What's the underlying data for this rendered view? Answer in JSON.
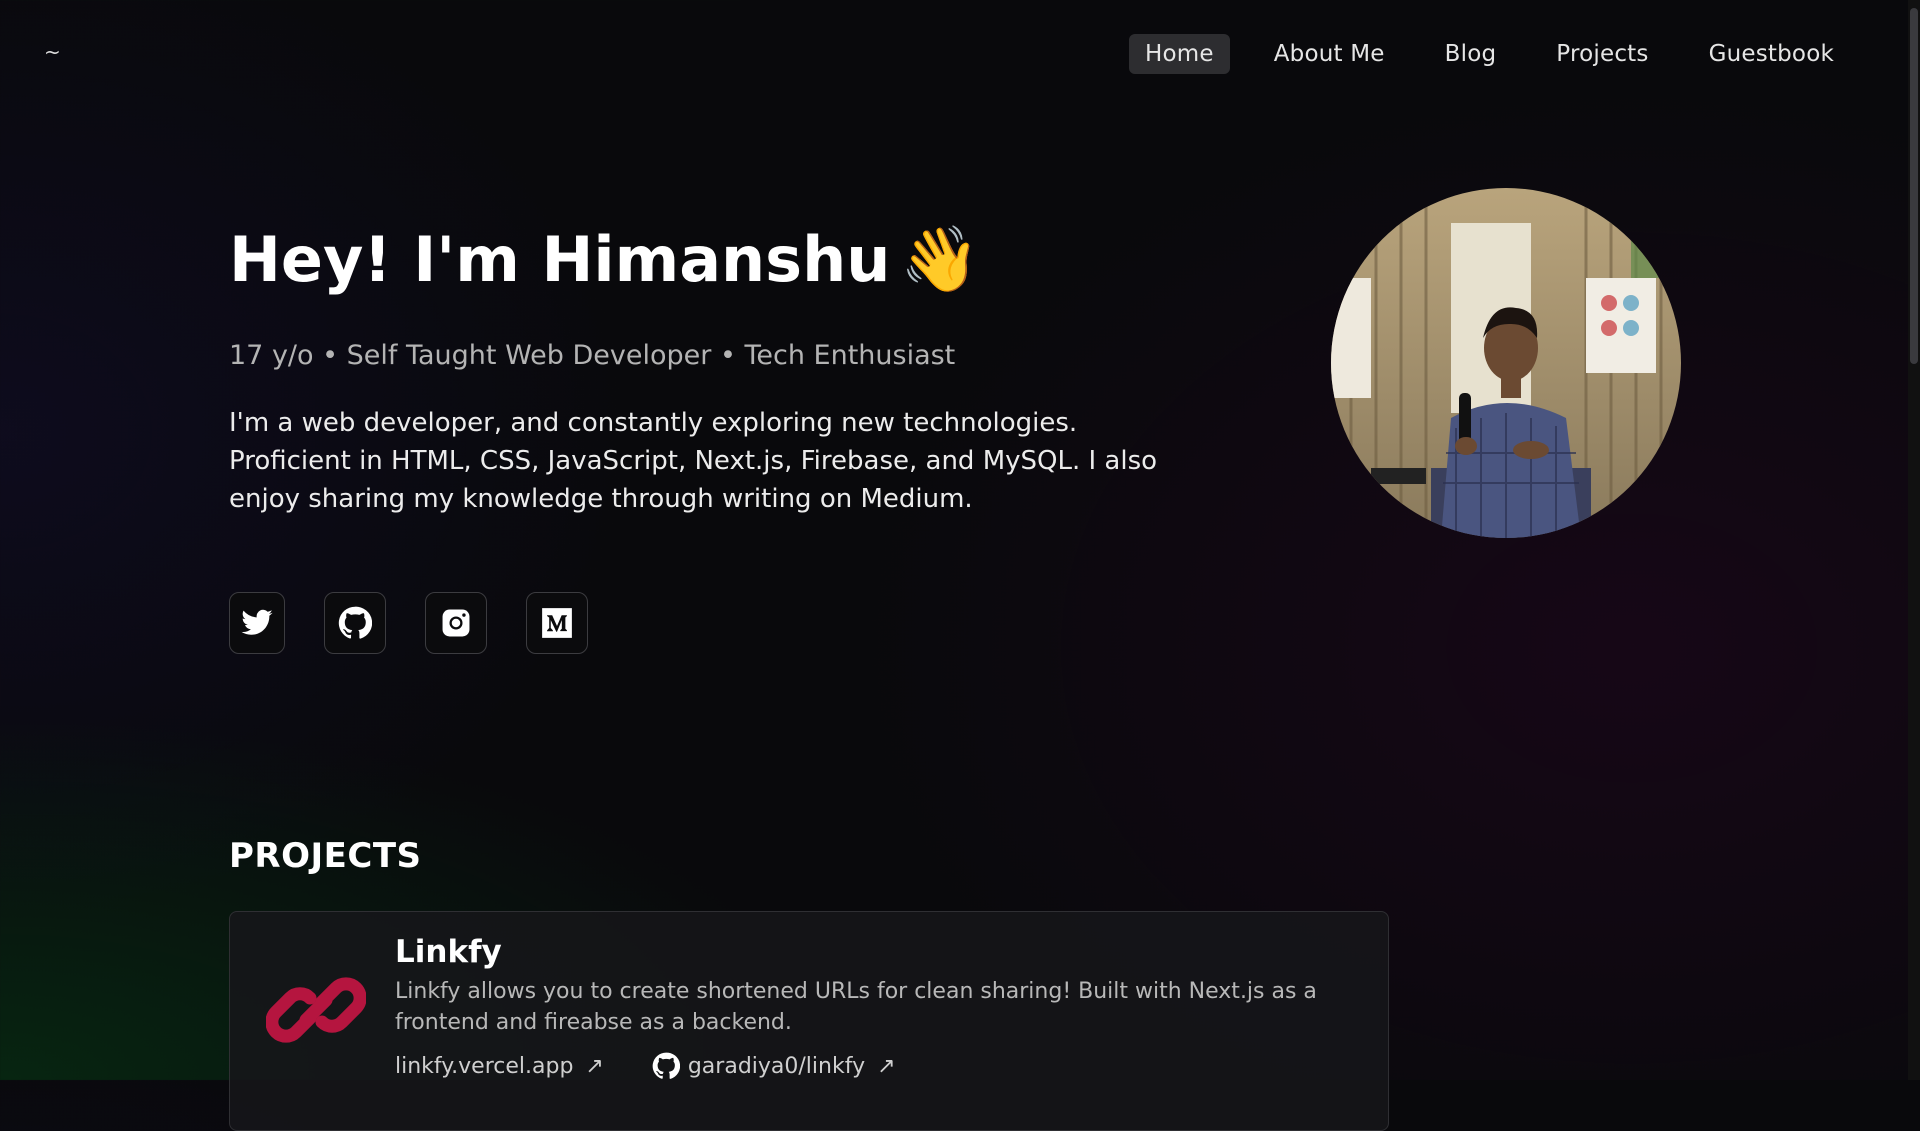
{
  "header": {
    "logo": "~",
    "nav": [
      {
        "label": "Home",
        "active": true
      },
      {
        "label": "About Me"
      },
      {
        "label": "Blog"
      },
      {
        "label": "Projects"
      },
      {
        "label": "Guestbook"
      }
    ]
  },
  "hero": {
    "title": "Hey! I'm Himanshu",
    "wave_emoji": "👋",
    "subtitle": "17 y/o • Self Taught Web Developer • Tech Enthusiast",
    "bio": "I'm a web developer, and constantly exploring new technologies. Proficient in HTML, CSS, JavaScript, Next.js, Firebase, and MySQL. I also enjoy sharing my knowledge through writing on Medium."
  },
  "socials": [
    {
      "icon": "twitter-icon"
    },
    {
      "icon": "github-icon"
    },
    {
      "icon": "instagram-icon"
    },
    {
      "icon": "medium-icon"
    }
  ],
  "avatar": {
    "icon": "profile-photo"
  },
  "projects": {
    "heading": "PROJECTS",
    "items": [
      {
        "name": "Linkfy",
        "description": "Linkfy allows you to create shortened URLs for clean sharing! Built with Next.js as a frontend and fireabse as a backend.",
        "site": "linkfy.vercel.app",
        "repo": "garadiya0/linkfy",
        "arrow": "↗",
        "icon": "chain-link-icon"
      }
    ]
  },
  "colors": {
    "accent": "#b5153f",
    "background": "#09090c",
    "nav_active": "#2d2d30"
  }
}
